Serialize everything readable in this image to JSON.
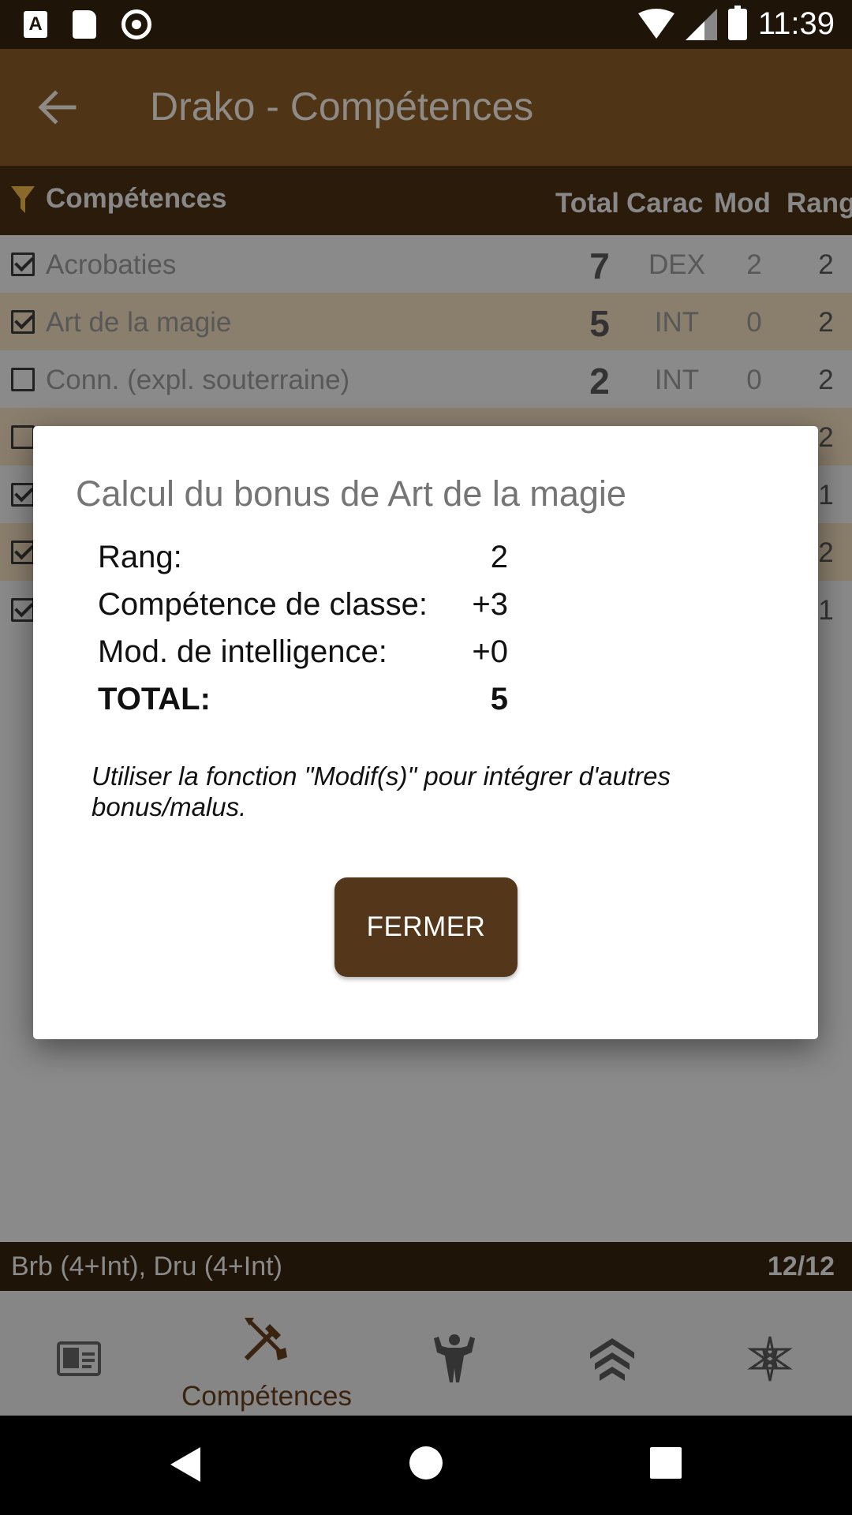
{
  "status_bar": {
    "time": "11:39",
    "notif_a": "A"
  },
  "app_bar": {
    "title": "Drako - Compétences"
  },
  "table": {
    "headers": {
      "skills": "Compétences",
      "total": "Total",
      "carac": "Carac",
      "mod": "Mod",
      "rang": "Rang"
    },
    "rows": [
      {
        "checked": true,
        "name": "Acrobaties",
        "total": "7",
        "carac": "DEX",
        "mod": "2",
        "rang": "2"
      },
      {
        "checked": true,
        "name": "Art de la magie",
        "total": "5",
        "carac": "INT",
        "mod": "0",
        "rang": "2"
      },
      {
        "checked": false,
        "name": "Conn. (expl. souterraine)",
        "total": "2",
        "carac": "INT",
        "mod": "0",
        "rang": "2"
      },
      {
        "checked": false,
        "name": "",
        "total": "",
        "carac": "",
        "mod": "",
        "rang": "2"
      },
      {
        "checked": true,
        "name": "",
        "total": "",
        "carac": "",
        "mod": "",
        "rang": "1"
      },
      {
        "checked": true,
        "name": "",
        "total": "",
        "carac": "",
        "mod": "",
        "rang": "2"
      },
      {
        "checked": true,
        "name": "",
        "total": "",
        "carac": "",
        "mod": "",
        "rang": "1"
      }
    ]
  },
  "points_bar": {
    "classes": "Brb (4+Int), Dru (4+Int)",
    "count": "12/12"
  },
  "bottom_nav": {
    "items": [
      {
        "icon": "id-card-icon",
        "label": ""
      },
      {
        "icon": "crossed-tools-icon",
        "label": "Compétences",
        "active": true
      },
      {
        "icon": "strongman-icon",
        "label": ""
      },
      {
        "icon": "rank-chevrons-icon",
        "label": ""
      },
      {
        "icon": "heptagram-icon",
        "label": ""
      }
    ]
  },
  "dialog": {
    "title": "Calcul du bonus de Art de la magie",
    "calc": [
      {
        "label": "Rang:",
        "value": "2"
      },
      {
        "label": "Compétence de classe:",
        "value": "+3"
      },
      {
        "label": "Mod. de intelligence:",
        "value": "+0"
      },
      {
        "label": "TOTAL:",
        "value": "5"
      }
    ],
    "note": "Utiliser la fonction \"Modif(s)\" pour intégrer d'autres bonus/malus.",
    "close_label": "FERMER"
  },
  "colors": {
    "status_bar": "#1f1408",
    "app_bar": "#4f3516",
    "table_header": "#2a1b0b",
    "accent_button": "#54361a",
    "scrim_gray": "#8a8a8a"
  }
}
